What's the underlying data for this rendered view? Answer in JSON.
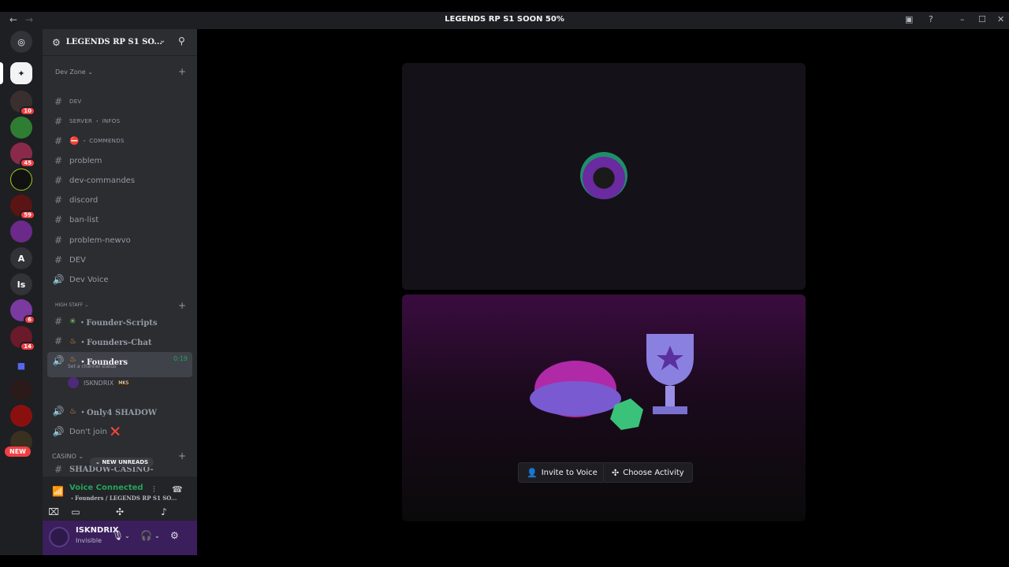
{
  "window": {
    "title": "LEGENDS RP S1 SOON 50%",
    "back_glyph": "←",
    "forward_glyph": "→",
    "icons": [
      "inbox-icon",
      "help-icon",
      "minimize-icon",
      "maximize-icon",
      "close-icon"
    ]
  },
  "guilds": {
    "badges": [
      "10",
      "45",
      "59",
      "6",
      "14"
    ],
    "letters": [
      "A",
      "Is"
    ],
    "new_label": "NEW"
  },
  "server": {
    "name": "LEGENDS RP S1 SO..."
  },
  "categories": {
    "dev_zone": "Dev Zone",
    "high_staff": "HIGH STAFF",
    "casino": "CASINO"
  },
  "channels": {
    "dev_zone": [
      {
        "label": "DEV",
        "type": "text",
        "style": "small"
      },
      {
        "label": "SERVER ・ INFOS",
        "type": "text",
        "style": "small"
      },
      {
        "label": "・ COMMENDS",
        "type": "text",
        "style": "small",
        "emoji": "⛔"
      },
      {
        "label": "problem",
        "type": "text"
      },
      {
        "label": "dev-commandes",
        "type": "text"
      },
      {
        "label": "discord",
        "type": "text"
      },
      {
        "label": "ban-list",
        "type": "text"
      },
      {
        "label": "problem-newvo",
        "type": "text"
      },
      {
        "label": "DEV",
        "type": "text"
      },
      {
        "label": "Dev Voice",
        "type": "voice"
      }
    ],
    "high_staff": [
      {
        "label": "・Founder-Scripts",
        "type": "text",
        "emoji": "✳"
      },
      {
        "label": "・Founders-Chat",
        "type": "text",
        "emoji": "♨"
      },
      {
        "label": "・Founders",
        "type": "voice",
        "emoji": "♨",
        "timer": "0:19",
        "status": "Set a channel status"
      },
      {
        "label": "・Only4 SHADOW",
        "type": "voice",
        "emoji": "♨"
      },
      {
        "label": "Don't join",
        "type": "voice",
        "emoji_after": "❌"
      }
    ],
    "casino": [
      {
        "label": "SHADOW-CASINO-",
        "type": "text"
      }
    ]
  },
  "voice_user": {
    "name": "ISKNDRIX",
    "tag": "MKS"
  },
  "new_unreads": "NEW UNREADS",
  "voice_panel": {
    "status": "Voice Connected",
    "channel": "・Founders / LEGENDS RP S1 SO..."
  },
  "user": {
    "name": "ISKNDRIX",
    "status": "Invisible"
  },
  "stage": {
    "invite_label": "Invite to Voice",
    "activity_label": "Choose Activity"
  },
  "colors": {
    "accent_green": "#23a55a",
    "sidebar": "#2b2d31",
    "guild_bar": "#1e1f22",
    "user_panel": "#3b1f5c",
    "mention_red": "#f23f43"
  }
}
